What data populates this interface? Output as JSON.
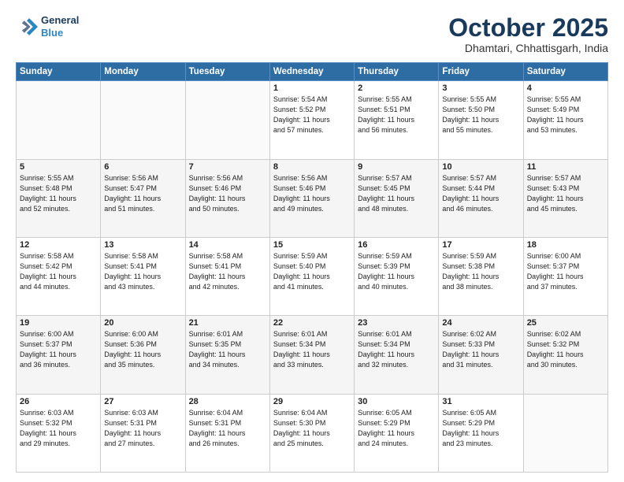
{
  "header": {
    "logo_line1": "General",
    "logo_line2": "Blue",
    "month": "October 2025",
    "location": "Dhamtari, Chhattisgarh, India"
  },
  "weekdays": [
    "Sunday",
    "Monday",
    "Tuesday",
    "Wednesday",
    "Thursday",
    "Friday",
    "Saturday"
  ],
  "weeks": [
    [
      {
        "day": "",
        "text": ""
      },
      {
        "day": "",
        "text": ""
      },
      {
        "day": "",
        "text": ""
      },
      {
        "day": "1",
        "text": "Sunrise: 5:54 AM\nSunset: 5:52 PM\nDaylight: 11 hours\nand 57 minutes."
      },
      {
        "day": "2",
        "text": "Sunrise: 5:55 AM\nSunset: 5:51 PM\nDaylight: 11 hours\nand 56 minutes."
      },
      {
        "day": "3",
        "text": "Sunrise: 5:55 AM\nSunset: 5:50 PM\nDaylight: 11 hours\nand 55 minutes."
      },
      {
        "day": "4",
        "text": "Sunrise: 5:55 AM\nSunset: 5:49 PM\nDaylight: 11 hours\nand 53 minutes."
      }
    ],
    [
      {
        "day": "5",
        "text": "Sunrise: 5:55 AM\nSunset: 5:48 PM\nDaylight: 11 hours\nand 52 minutes."
      },
      {
        "day": "6",
        "text": "Sunrise: 5:56 AM\nSunset: 5:47 PM\nDaylight: 11 hours\nand 51 minutes."
      },
      {
        "day": "7",
        "text": "Sunrise: 5:56 AM\nSunset: 5:46 PM\nDaylight: 11 hours\nand 50 minutes."
      },
      {
        "day": "8",
        "text": "Sunrise: 5:56 AM\nSunset: 5:46 PM\nDaylight: 11 hours\nand 49 minutes."
      },
      {
        "day": "9",
        "text": "Sunrise: 5:57 AM\nSunset: 5:45 PM\nDaylight: 11 hours\nand 48 minutes."
      },
      {
        "day": "10",
        "text": "Sunrise: 5:57 AM\nSunset: 5:44 PM\nDaylight: 11 hours\nand 46 minutes."
      },
      {
        "day": "11",
        "text": "Sunrise: 5:57 AM\nSunset: 5:43 PM\nDaylight: 11 hours\nand 45 minutes."
      }
    ],
    [
      {
        "day": "12",
        "text": "Sunrise: 5:58 AM\nSunset: 5:42 PM\nDaylight: 11 hours\nand 44 minutes."
      },
      {
        "day": "13",
        "text": "Sunrise: 5:58 AM\nSunset: 5:41 PM\nDaylight: 11 hours\nand 43 minutes."
      },
      {
        "day": "14",
        "text": "Sunrise: 5:58 AM\nSunset: 5:41 PM\nDaylight: 11 hours\nand 42 minutes."
      },
      {
        "day": "15",
        "text": "Sunrise: 5:59 AM\nSunset: 5:40 PM\nDaylight: 11 hours\nand 41 minutes."
      },
      {
        "day": "16",
        "text": "Sunrise: 5:59 AM\nSunset: 5:39 PM\nDaylight: 11 hours\nand 40 minutes."
      },
      {
        "day": "17",
        "text": "Sunrise: 5:59 AM\nSunset: 5:38 PM\nDaylight: 11 hours\nand 38 minutes."
      },
      {
        "day": "18",
        "text": "Sunrise: 6:00 AM\nSunset: 5:37 PM\nDaylight: 11 hours\nand 37 minutes."
      }
    ],
    [
      {
        "day": "19",
        "text": "Sunrise: 6:00 AM\nSunset: 5:37 PM\nDaylight: 11 hours\nand 36 minutes."
      },
      {
        "day": "20",
        "text": "Sunrise: 6:00 AM\nSunset: 5:36 PM\nDaylight: 11 hours\nand 35 minutes."
      },
      {
        "day": "21",
        "text": "Sunrise: 6:01 AM\nSunset: 5:35 PM\nDaylight: 11 hours\nand 34 minutes."
      },
      {
        "day": "22",
        "text": "Sunrise: 6:01 AM\nSunset: 5:34 PM\nDaylight: 11 hours\nand 33 minutes."
      },
      {
        "day": "23",
        "text": "Sunrise: 6:01 AM\nSunset: 5:34 PM\nDaylight: 11 hours\nand 32 minutes."
      },
      {
        "day": "24",
        "text": "Sunrise: 6:02 AM\nSunset: 5:33 PM\nDaylight: 11 hours\nand 31 minutes."
      },
      {
        "day": "25",
        "text": "Sunrise: 6:02 AM\nSunset: 5:32 PM\nDaylight: 11 hours\nand 30 minutes."
      }
    ],
    [
      {
        "day": "26",
        "text": "Sunrise: 6:03 AM\nSunset: 5:32 PM\nDaylight: 11 hours\nand 29 minutes."
      },
      {
        "day": "27",
        "text": "Sunrise: 6:03 AM\nSunset: 5:31 PM\nDaylight: 11 hours\nand 27 minutes."
      },
      {
        "day": "28",
        "text": "Sunrise: 6:04 AM\nSunset: 5:31 PM\nDaylight: 11 hours\nand 26 minutes."
      },
      {
        "day": "29",
        "text": "Sunrise: 6:04 AM\nSunset: 5:30 PM\nDaylight: 11 hours\nand 25 minutes."
      },
      {
        "day": "30",
        "text": "Sunrise: 6:05 AM\nSunset: 5:29 PM\nDaylight: 11 hours\nand 24 minutes."
      },
      {
        "day": "31",
        "text": "Sunrise: 6:05 AM\nSunset: 5:29 PM\nDaylight: 11 hours\nand 23 minutes."
      },
      {
        "day": "",
        "text": ""
      }
    ]
  ]
}
